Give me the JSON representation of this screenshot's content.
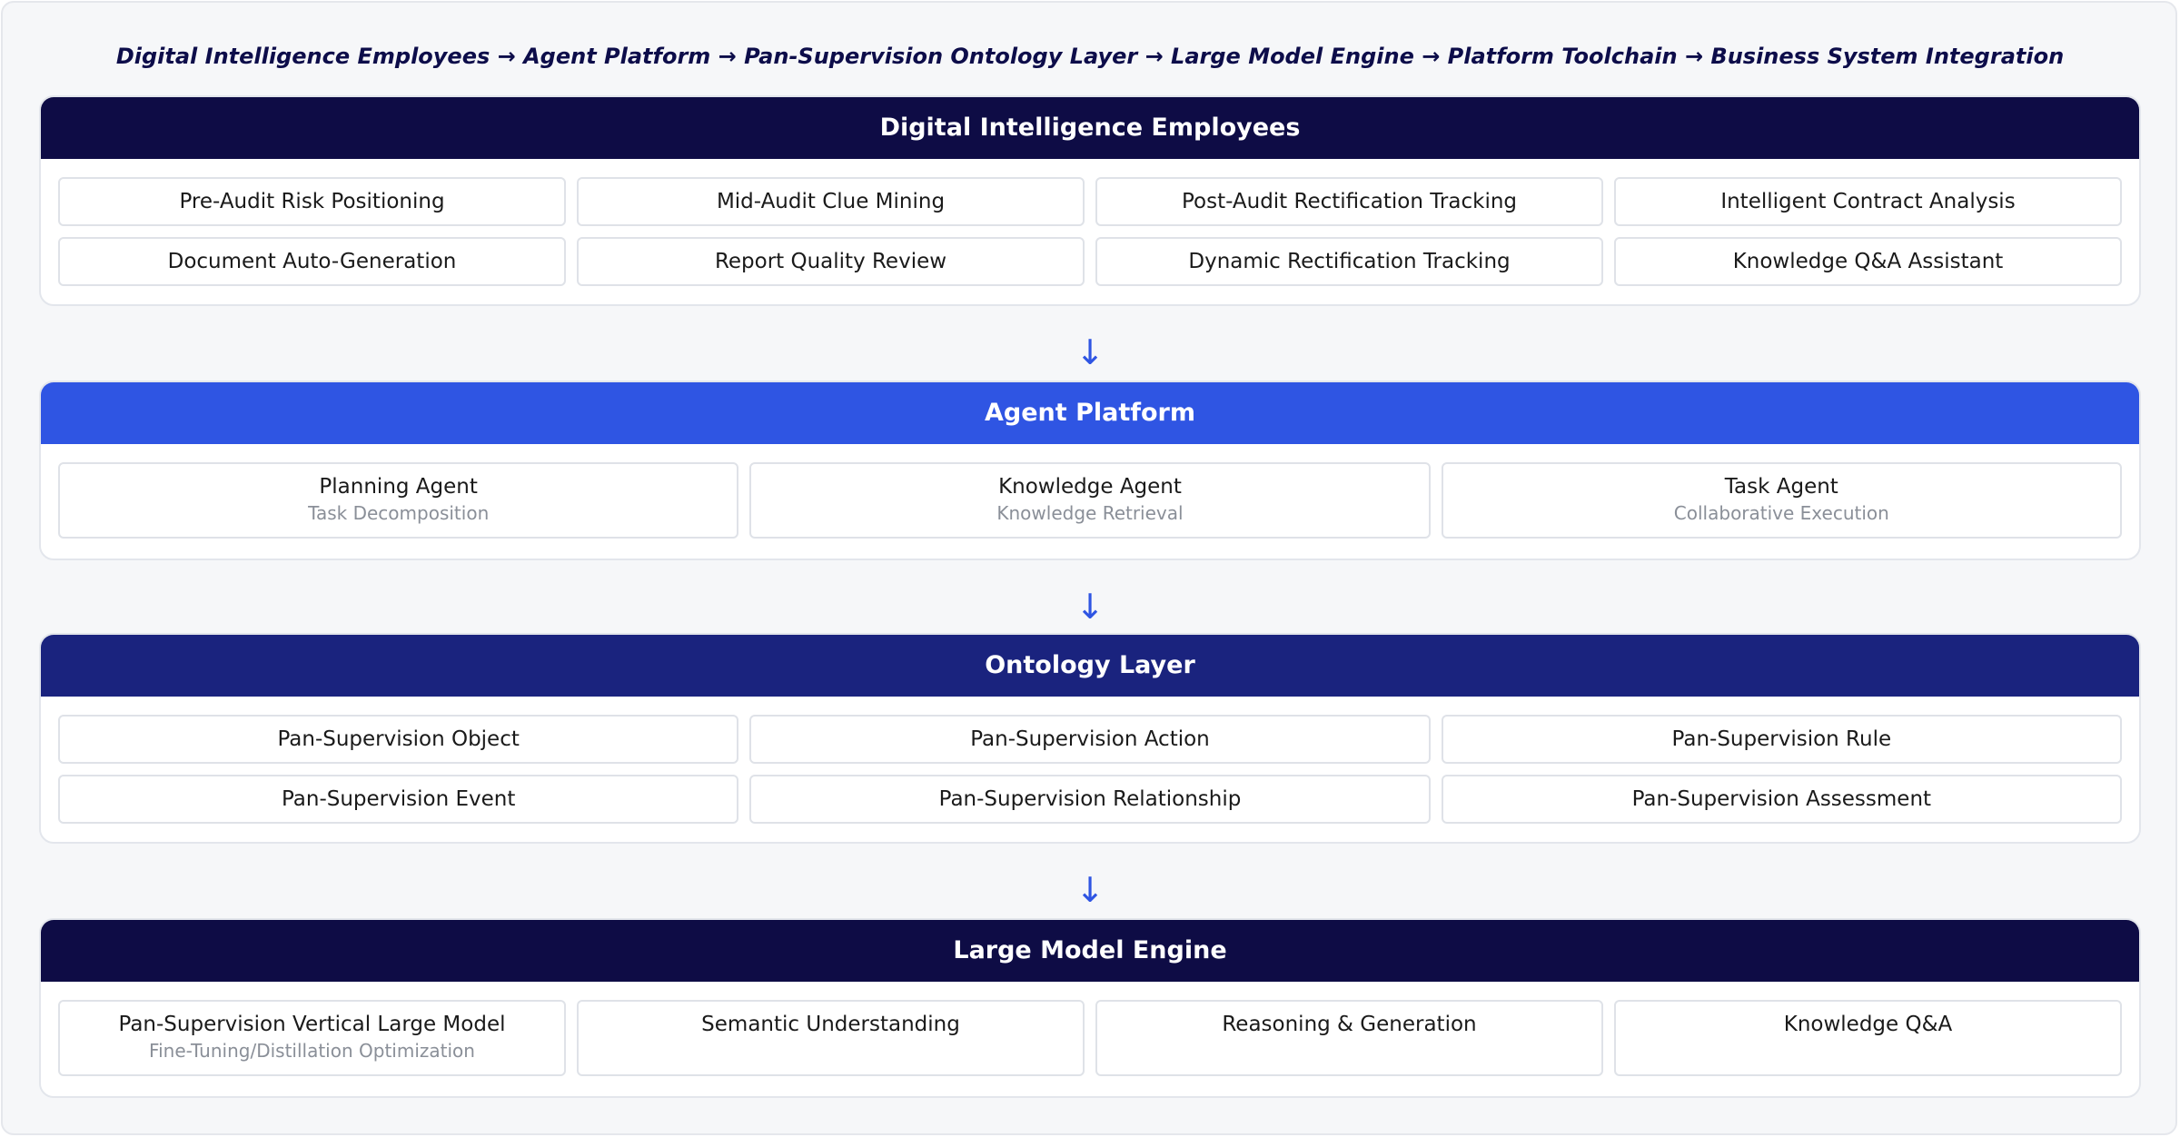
{
  "flow_title": "Digital Intelligence Employees → Agent Platform → Pan-Supervision Ontology Layer → Large Model Engine → Platform Toolchain → Business System Integration",
  "arrow_glyph": "↓",
  "colors": {
    "dark_navy": "#0e0c45",
    "blue": "#2f55e3",
    "navy": "#1a237e",
    "arrow": "#2f55e3"
  },
  "layers": {
    "employees": {
      "title": "Digital Intelligence Employees",
      "items": [
        {
          "label": "Pre-Audit Risk Positioning"
        },
        {
          "label": "Mid-Audit Clue Mining"
        },
        {
          "label": "Post-Audit Rectification Tracking"
        },
        {
          "label": "Intelligent Contract Analysis"
        },
        {
          "label": "Document Auto-Generation"
        },
        {
          "label": "Report Quality Review"
        },
        {
          "label": "Dynamic Rectification Tracking"
        },
        {
          "label": "Knowledge Q&A Assistant"
        }
      ]
    },
    "agent": {
      "title": "Agent Platform",
      "items": [
        {
          "label": "Planning Agent",
          "sub": "Task Decomposition"
        },
        {
          "label": "Knowledge Agent",
          "sub": "Knowledge Retrieval"
        },
        {
          "label": "Task Agent",
          "sub": "Collaborative Execution"
        }
      ]
    },
    "ontology": {
      "title": "Ontology Layer",
      "items": [
        {
          "label": "Pan-Supervision Object"
        },
        {
          "label": "Pan-Supervision Action"
        },
        {
          "label": "Pan-Supervision Rule"
        },
        {
          "label": "Pan-Supervision Event"
        },
        {
          "label": "Pan-Supervision Relationship"
        },
        {
          "label": "Pan-Supervision Assessment"
        }
      ]
    },
    "engine": {
      "title": "Large Model Engine",
      "items": [
        {
          "label": "Pan-Supervision Vertical Large Model",
          "sub": "Fine-Tuning/Distillation Optimization"
        },
        {
          "label": "Semantic Understanding"
        },
        {
          "label": "Reasoning & Generation"
        },
        {
          "label": "Knowledge Q&A"
        }
      ]
    }
  }
}
